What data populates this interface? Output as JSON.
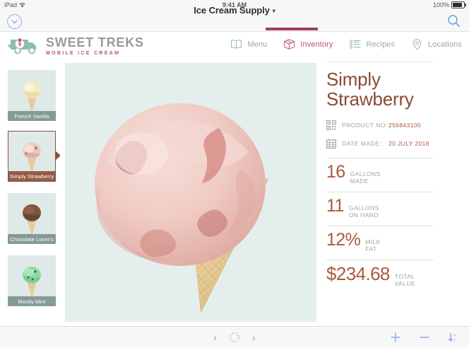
{
  "status_bar": {
    "device": "iPad",
    "wifi_icon": "wifi-icon",
    "time": "9:41 AM",
    "battery_percent": "100%",
    "battery_icon": "battery-full-icon"
  },
  "title_bar": {
    "back_icon": "chevron-down-circle-icon",
    "title": "Ice Cream Supply",
    "title_caret": "▾",
    "search_icon": "search-icon",
    "active_tab_accent": "#a83c56"
  },
  "brand": {
    "truck_icon": "ice-cream-truck-icon",
    "name": "SWEET TREKS",
    "tagline": "MOBILE ICE CREAM",
    "name_color": "#9a9a9a",
    "tagline_color": "#b5566c"
  },
  "nav": {
    "items": [
      {
        "label": "Menu",
        "icon": "open-book-icon",
        "active": false
      },
      {
        "label": "Inventory",
        "icon": "box-icon",
        "active": true
      },
      {
        "label": "Recipes",
        "icon": "list-icon",
        "active": false
      },
      {
        "label": "Locations",
        "icon": "map-pin-icon",
        "active": false
      }
    ],
    "active_color": "#b5566c",
    "inactive_color": "#9aa7a4"
  },
  "sidebar": {
    "items": [
      {
        "label": "French Vanilla",
        "selected": false,
        "scoop_color": "#f2ebc0",
        "scoop_shade": "#e3d69d"
      },
      {
        "label": "Simply Strawberry",
        "selected": true,
        "scoop_color": "#eec9c4",
        "scoop_shade": "#d9a49e"
      },
      {
        "label": "Chocolate Lover's",
        "selected": false,
        "scoop_color": "#7b5340",
        "scoop_shade": "#5f3e2f"
      },
      {
        "label": "Mostly Mint",
        "selected": false,
        "scoop_color": "#8ddba4",
        "scoop_shade": "#6ec48a"
      }
    ],
    "selected_border_color": "#8a5038",
    "caption_bg": "#768e8b",
    "tile_bg": "#dfeae8"
  },
  "hero": {
    "alt": "simply-strawberry-ice-cream-cone",
    "background": "#e4eeed"
  },
  "detail": {
    "product_name": "Simply Strawberry",
    "meta": [
      {
        "icon": "qr-code-icon",
        "label": "PRODUCT NO:",
        "value": "256843100"
      },
      {
        "icon": "calendar-icon",
        "label": "DATE MADE:",
        "value": "20 JULY 2018"
      }
    ],
    "stats": [
      {
        "value": "16",
        "label_line1": "GALLONS",
        "label_line2": "MADE"
      },
      {
        "value": "11",
        "label_line1": "GALLONS",
        "label_line2": "ON HAND"
      },
      {
        "value": "12%",
        "label_line1": "MILK",
        "label_line2": "FAT"
      },
      {
        "value": "$234.68",
        "label_line1": "TOTAL",
        "label_line2": "VALUE"
      }
    ],
    "accent_color": "#a85a3e",
    "label_color": "#9ba6a4"
  },
  "bottom_bar": {
    "prev_icon": "chevron-left-icon",
    "prev_label": "‹",
    "record_icon": "record-circle-icon",
    "next_icon": "chevron-right-icon",
    "next_label": "›",
    "add_icon": "plus-icon",
    "remove_icon": "minus-icon",
    "sort_icon": "sort-az-icon"
  }
}
